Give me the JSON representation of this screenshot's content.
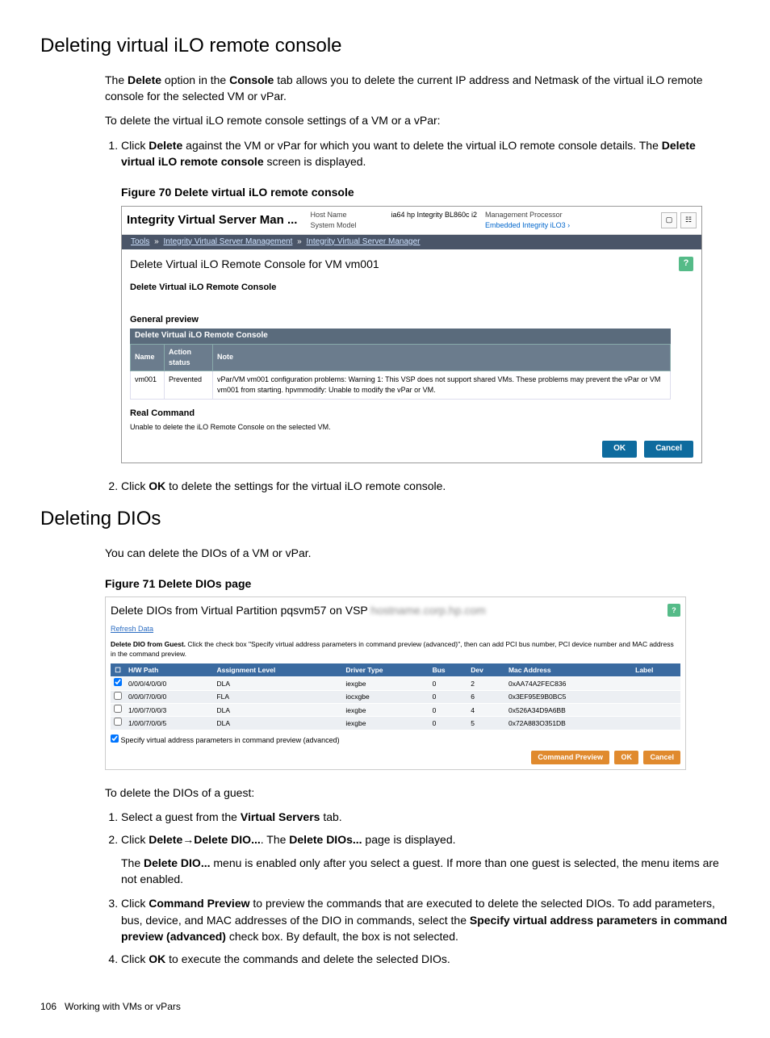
{
  "h1_a": "Deleting virtual iLO remote console",
  "p1_pre": "The ",
  "p1_b1": "Delete",
  "p1_mid": " option in the ",
  "p1_b2": "Console",
  "p1_post": " tab allows you to delete the current IP address and Netmask of the virtual iLO remote console for the selected VM or vPar.",
  "p2": "To delete the virtual iLO remote console settings of a VM or a vPar:",
  "step1_pre": "Click ",
  "step1_b1": "Delete",
  "step1_mid": " against the VM or vPar for which you want to delete the virtual iLO remote console details. The ",
  "step1_b2": "Delete virtual iLO remote console",
  "step1_post": " screen is displayed.",
  "fig70_cap": "Figure 70 Delete virtual iLO remote console",
  "fig70": {
    "title": "Integrity Virtual Server Man ...",
    "hostname_k": "Host Name",
    "hostname_v": "",
    "model_k": "System Model",
    "model_v": "ia64 hp Integrity BL860c i2",
    "mp_k": "Management Processor",
    "mp_v": "Embedded Integrity iLO3 ›",
    "crumb_tools": "Tools",
    "crumb_1": "Integrity Virtual Server Management",
    "crumb_2": "Integrity Virtual Server Manager",
    "sect_title": "Delete Virtual iLO Remote Console for VM vm001",
    "sub1": "Delete Virtual iLO Remote Console",
    "sub2": "General preview",
    "tbl_caption": "Delete Virtual iLO Remote Console",
    "th_name": "Name",
    "th_action": "Action status",
    "th_note": "Note",
    "row_name": "vm001",
    "row_action": "Prevented",
    "row_note": "vPar/VM vm001 configuration problems: Warning 1: This VSP does not support shared VMs. These problems may prevent the vPar or VM vm001 from starting. hpvmmodify: Unable to modify the vPar or VM.",
    "rc": "Real Command",
    "rct": "Unable to delete the iLO Remote Console on the selected VM.",
    "ok": "OK",
    "cancel": "Cancel"
  },
  "step2_pre": "Click ",
  "step2_b": "OK",
  "step2_post": " to delete the settings for the virtual iLO remote console.",
  "h1_b": "Deleting DIOs",
  "p3": "You can delete the DIOs of a VM or vPar.",
  "fig71_cap": "Figure 71 Delete DIOs page",
  "fig71": {
    "title_pre": "Delete DIOs from Virtual Partition pqsvm57 on VSP ",
    "title_blur": "hostname.corp.hp.com",
    "refresh": "Refresh Data",
    "instr_b": "Delete DIO from Guest.",
    "instr": " Click the check box \"Specify virtual address parameters in command preview (advanced)\", then can add PCI bus number, PCI device number and MAC address in the command preview.",
    "th_cb": "",
    "th_hw": "H/W Path",
    "th_al": "Assignment Level",
    "th_dt": "Driver Type",
    "th_bus": "Bus",
    "th_dev": "Dev",
    "th_mac": "Mac Address",
    "th_label": "Label",
    "rows": [
      {
        "cb": true,
        "hw": "0/0/0/4/0/0/0",
        "al": "DLA",
        "dt": "iexgbe",
        "bus": "0",
        "dev": "2",
        "mac": "0xAA74A2FEC836",
        "label": ""
      },
      {
        "cb": false,
        "hw": "0/0/0/7/0/0/0",
        "al": "FLA",
        "dt": "iocxgbe",
        "bus": "0",
        "dev": "6",
        "mac": "0x3EF95E9B0BC5",
        "label": ""
      },
      {
        "cb": false,
        "hw": "1/0/0/7/0/0/3",
        "al": "DLA",
        "dt": "iexgbe",
        "bus": "0",
        "dev": "4",
        "mac": "0x526A34D9A6BB",
        "label": ""
      },
      {
        "cb": false,
        "hw": "1/0/0/7/0/0/5",
        "al": "DLA",
        "dt": "iexgbe",
        "bus": "0",
        "dev": "5",
        "mac": "0x72A883O351DB",
        "label": ""
      }
    ],
    "adv": "Specify virtual address parameters in command preview (advanced)",
    "cp": "Command Preview",
    "ok": "OK",
    "cancel": "Cancel"
  },
  "p4": "To delete the DIOs of a guest:",
  "b_step1_pre": "Select a guest from the ",
  "b_step1_b": "Virtual Servers",
  "b_step1_post": " tab.",
  "b_step2_pre": "Click ",
  "b_step2_b1": "Delete",
  "b_step2_arrow": "→",
  "b_step2_b2": "Delete DIO...",
  "b_step2_mid": ". The ",
  "b_step2_b3": "Delete DIOs...",
  "b_step2_post": " page is displayed.",
  "b_step2_sub_pre": "The ",
  "b_step2_sub_b": "Delete DIO...",
  "b_step2_sub_post": " menu is enabled only after you select a guest. If more than one guest is selected, the menu items are not enabled.",
  "b_step3_pre": "Click ",
  "b_step3_b1": "Command Preview",
  "b_step3_mid": " to preview the commands that are executed to delete the selected DIOs. To add parameters, bus, device, and MAC addresses of the DIO in commands, select the ",
  "b_step3_b2": "Specify virtual address parameters in command preview (advanced)",
  "b_step3_post": " check box. By default, the box is not selected.",
  "b_step4_pre": "Click ",
  "b_step4_b": "OK",
  "b_step4_post": " to execute the commands and delete the selected DIOs.",
  "footer_page": "106",
  "footer_text": "Working with VMs or vPars"
}
